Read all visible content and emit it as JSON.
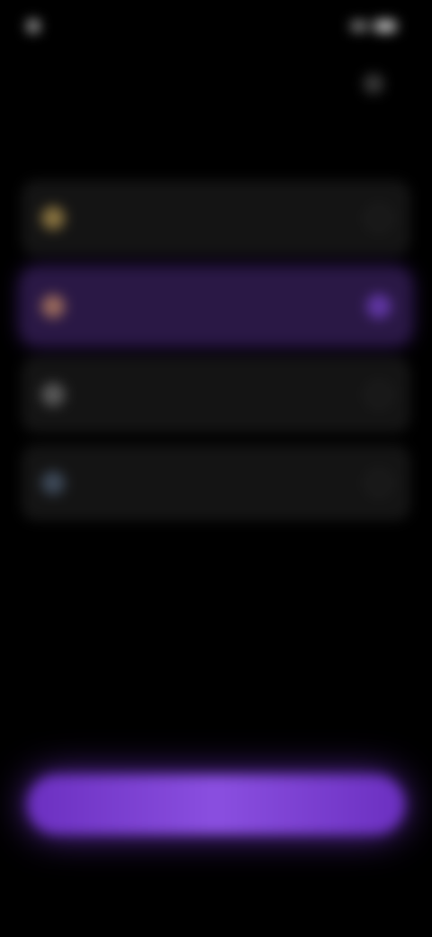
{
  "status_bar": {
    "time": "",
    "icons": [
      "signal-icon",
      "battery-icon"
    ]
  },
  "header": {
    "title": ""
  },
  "options": [
    {
      "label": "",
      "icon": "option-icon-gold",
      "icon_color": "#8a7440",
      "selected": false
    },
    {
      "label": "",
      "icon": "option-icon-peach",
      "icon_color": "#9a6a5c",
      "selected": true
    },
    {
      "label": "",
      "icon": "option-icon-gray",
      "icon_color": "#5a5a5a",
      "selected": false
    },
    {
      "label": "",
      "icon": "option-icon-slate",
      "icon_color": "#3e4a5a",
      "selected": false
    }
  ],
  "cta": {
    "label": ""
  },
  "footer": {
    "note": ""
  },
  "colors": {
    "background": "#000000",
    "card": "#141414",
    "selected_card": "#2a1845",
    "accent": "#8a4fe0"
  }
}
